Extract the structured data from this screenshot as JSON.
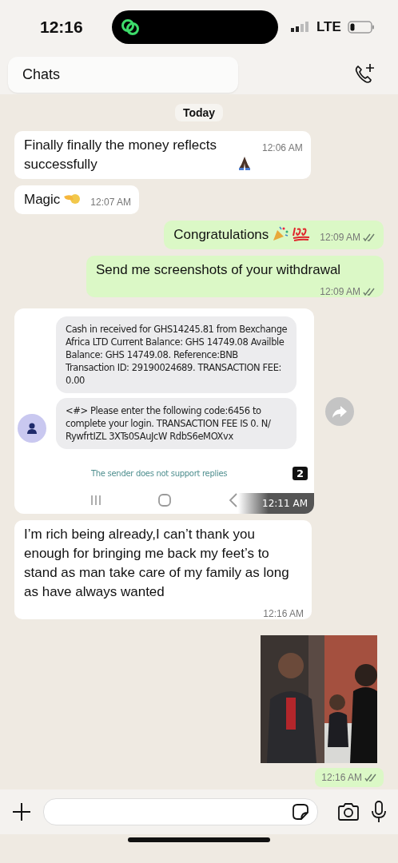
{
  "status_bar": {
    "time": "12:16",
    "network": "LTE"
  },
  "header": {
    "title": "Chats"
  },
  "date_divider": "Today",
  "messages": [
    {
      "kind": "text",
      "outgoing": false,
      "text": "Finally finally the money reflects successfully",
      "emoji": [
        {
          "kind": "pray"
        }
      ],
      "time": "12:06 AM"
    },
    {
      "kind": "text",
      "outgoing": false,
      "text": "Magic",
      "emoji": [
        {
          "kind": "hand"
        }
      ],
      "time": "12:07 AM"
    },
    {
      "kind": "text",
      "outgoing": true,
      "text": "Congratulations",
      "emoji": [
        {
          "kind": "party"
        },
        {
          "kind": "hundred"
        }
      ],
      "time": "12:09 AM",
      "read": true
    },
    {
      "kind": "text",
      "outgoing": true,
      "text": "Send me screenshots of your withdrawal",
      "time": "12:09 AM",
      "read": true
    },
    {
      "kind": "screenshot",
      "outgoing": false,
      "sms": [
        "Cash in received for GHS14245.81 from Bexchange Africa LTD Current Balance: GHS 14749.08 Availble Balance: GHS 14749.08. Reference:BNB Transaction ID: 29190024689. TRANSACTION FEE: 0.00",
        "<#> Please enter the following code:6456 to complete your login. TRANSACTION FEE IS 0. N/ RywfrtIZL 3XTs0SAuJcW RdbS6eMOXvx"
      ],
      "notice": "The sender does not support replies",
      "badge": "2",
      "time": "12:11 AM"
    },
    {
      "kind": "text",
      "outgoing": false,
      "text": "I’m rich being already,I can’t thank you enough for bringing me back my feet’s to stand as man take care of my family as long as have always wanted",
      "time": "12:16 AM"
    },
    {
      "outgoing": true,
      "time": "12:16 AM",
      "read": true
    }
  ]
}
